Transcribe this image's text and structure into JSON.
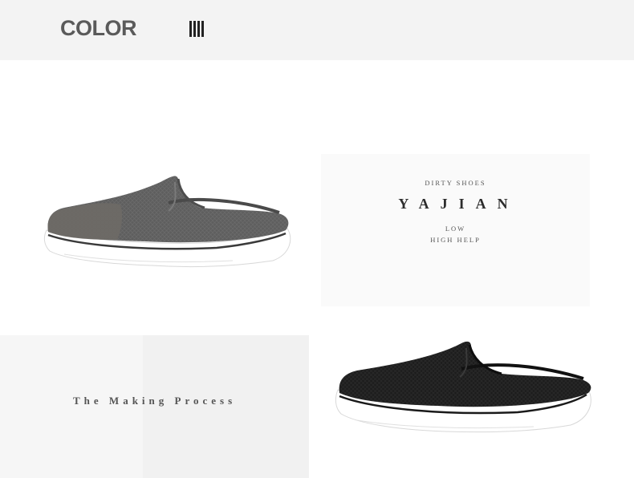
{
  "header": {
    "title": "COLOR",
    "icon": "bars-icon"
  },
  "card": {
    "tagline": "DIRTY SHOES",
    "brand": "YAJIAN",
    "line1": "LOW",
    "line2": "HIGH HELP"
  },
  "making": {
    "text": "The Making Process"
  },
  "products": [
    {
      "name": "grey-slipper-image",
      "color": "#5f5f5f"
    },
    {
      "name": "black-slipper-image",
      "color": "#1c1c1c"
    }
  ]
}
